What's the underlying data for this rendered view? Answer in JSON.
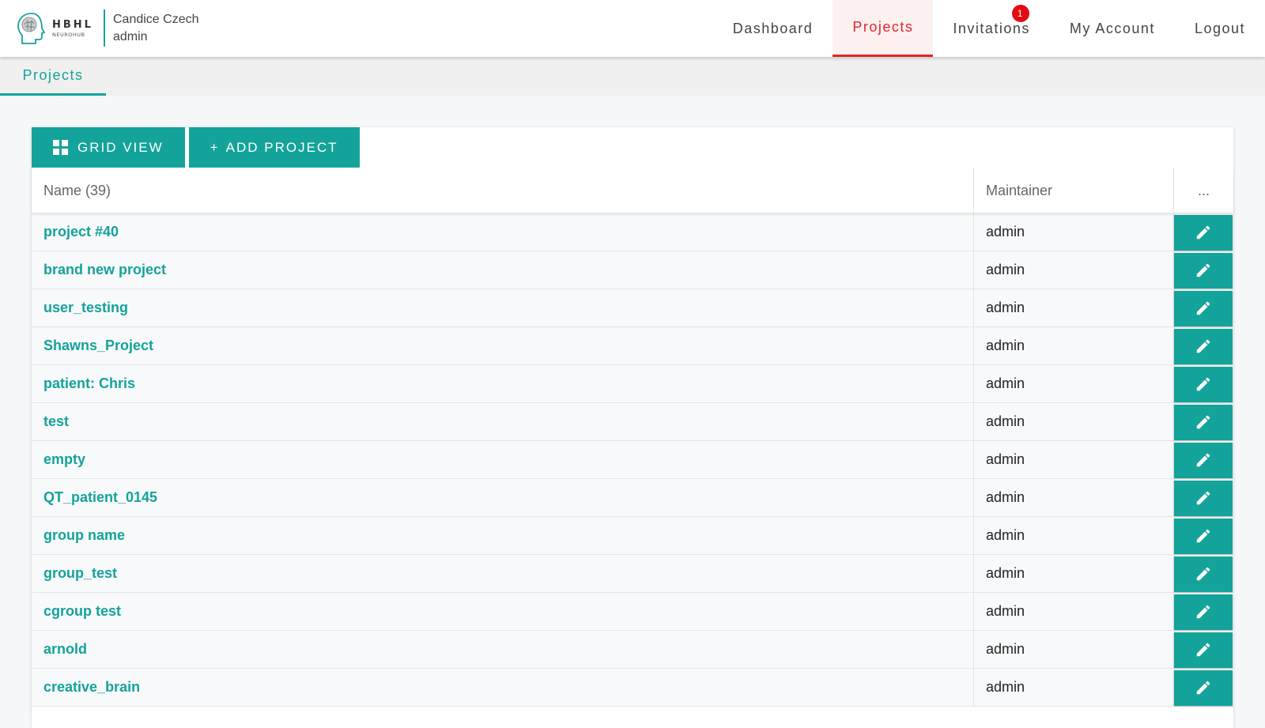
{
  "header": {
    "logo": {
      "title": "HBHL",
      "subtitle": "NEUROHUB"
    },
    "user": {
      "name": "Candice Czech",
      "role": "admin"
    },
    "nav": [
      {
        "label": "Dashboard",
        "active": false
      },
      {
        "label": "Projects",
        "active": true
      },
      {
        "label": "Invitations",
        "active": false,
        "badge": "1"
      },
      {
        "label": "My Account",
        "active": false
      },
      {
        "label": "Logout",
        "active": false
      }
    ]
  },
  "tabs": [
    {
      "label": "Projects",
      "active": true
    }
  ],
  "toolbar": {
    "grid_view_label": "GRID VIEW",
    "add_project_label": "ADD PROJECT",
    "add_project_prefix": "+"
  },
  "table": {
    "columns": {
      "name": "Name (39)",
      "maintainer": "Maintainer",
      "actions": "..."
    },
    "rows": [
      {
        "name": "project #40",
        "maintainer": "admin"
      },
      {
        "name": "brand new project",
        "maintainer": "admin"
      },
      {
        "name": "user_testing",
        "maintainer": "admin"
      },
      {
        "name": "Shawns_Project",
        "maintainer": "admin"
      },
      {
        "name": "patient: Chris",
        "maintainer": "admin"
      },
      {
        "name": "test",
        "maintainer": "admin"
      },
      {
        "name": "empty",
        "maintainer": "admin"
      },
      {
        "name": "QT_patient_0145",
        "maintainer": "admin"
      },
      {
        "name": "group name",
        "maintainer": "admin"
      },
      {
        "name": "group_test",
        "maintainer": "admin"
      },
      {
        "name": "cgroup test",
        "maintainer": "admin"
      },
      {
        "name": "arnold",
        "maintainer": "admin"
      },
      {
        "name": "creative_brain",
        "maintainer": "admin"
      }
    ]
  },
  "icons": {
    "logo": "brain-head-icon",
    "grid_view": "grid-icon",
    "edit": "pencil-icon"
  },
  "colors": {
    "accent": "#14a39a",
    "active_nav": "#e0262b",
    "badge": "#e50914"
  }
}
